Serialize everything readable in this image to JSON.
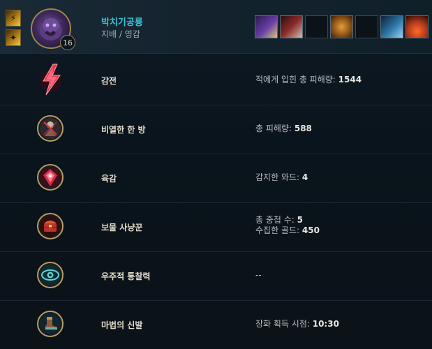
{
  "header": {
    "summoner_name": "박치기공룡",
    "rune_tree": "지배 / 영감",
    "champion_level": "16",
    "items": [
      {
        "name": "item-1",
        "color": "#6a3fa8"
      },
      {
        "name": "item-2",
        "color": "#8a2a2a"
      },
      {
        "name": "empty",
        "color": ""
      },
      {
        "name": "item-4",
        "color": "#a0621c"
      },
      {
        "name": "empty",
        "color": ""
      },
      {
        "name": "item-6",
        "color": "#2f78a8"
      },
      {
        "name": "item-7",
        "color": "#b03a1c"
      }
    ]
  },
  "runes": [
    {
      "name": "감전",
      "icon": "electrocute-icon",
      "stats": [
        {
          "label": "적에게 입힌 총 피해량: ",
          "value": "1544"
        }
      ]
    },
    {
      "name": "비열한 한 방",
      "icon": "cheap-shot-icon",
      "stats": [
        {
          "label": "총 피해량: ",
          "value": "588"
        }
      ]
    },
    {
      "name": "육감",
      "icon": "sixth-sense-icon",
      "stats": [
        {
          "label": "감지한 와드: ",
          "value": "4"
        }
      ]
    },
    {
      "name": "보물 사냥꾼",
      "icon": "treasure-hunter-icon",
      "stats": [
        {
          "label": "총 중첩 수: ",
          "value": "5"
        },
        {
          "label": "수집한 골드: ",
          "value": "450"
        }
      ]
    },
    {
      "name": "우주적 통찰력",
      "icon": "cosmic-insight-icon",
      "stats": [
        {
          "label": "--",
          "value": ""
        }
      ]
    },
    {
      "name": "마법의 신발",
      "icon": "magical-footwear-icon",
      "stats": [
        {
          "label": "장화 획득 시점: ",
          "value": "10:30"
        }
      ]
    }
  ],
  "colors": {
    "summoner_name": "#39c2d6",
    "domination_red": "#d23144",
    "frame_gold": "#b69c64"
  }
}
